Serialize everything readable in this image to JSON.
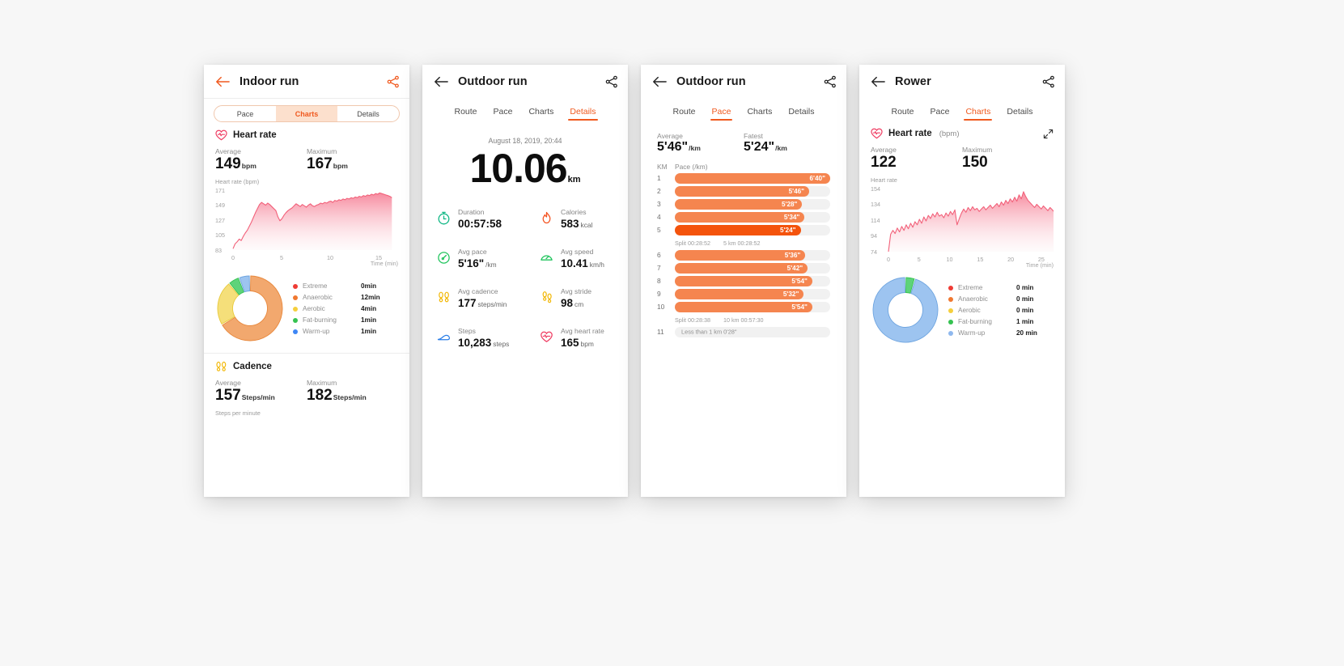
{
  "panels": [
    {
      "id": "indoor-run",
      "title": "Indoor run",
      "back_icon": "back-arrow-icon",
      "share_icon": "share-icon",
      "tab_style": "pill",
      "tabs": [
        {
          "label": "Pace",
          "active": false
        },
        {
          "label": "Charts",
          "active": true
        },
        {
          "label": "Details",
          "active": false
        }
      ],
      "heart_rate": {
        "icon": "heart-rate-icon",
        "title": "Heart rate",
        "unit_suffix": "",
        "average_label": "Average",
        "average_value": "149",
        "average_unit": "bpm",
        "maximum_label": "Maximum",
        "maximum_value": "167",
        "maximum_unit": "bpm",
        "axis_caption": "Heart rate (bpm)",
        "y_ticks": [
          "171",
          "149",
          "127",
          "105",
          "83"
        ],
        "x_ticks": [
          "0",
          "5",
          "10",
          "15"
        ],
        "time_caption": "Time (min)"
      },
      "zones": {
        "colors": {
          "extreme": "#ef3b34",
          "anaerobic": "#f07830",
          "aerobic": "#f5cf3d",
          "fat_burning": "#35c250",
          "warm_up": "#3e86f5"
        },
        "items": [
          {
            "name": "Extreme",
            "value": "0min",
            "color": "#ef3b34",
            "minutes": 0
          },
          {
            "name": "Anaerobic",
            "value": "12min",
            "color": "#f07830",
            "minutes": 12
          },
          {
            "name": "Aerobic",
            "value": "4min",
            "color": "#f5cf3d",
            "minutes": 4
          },
          {
            "name": "Fat-burning",
            "value": "1min",
            "color": "#35c250",
            "minutes": 1
          },
          {
            "name": "Warm-up",
            "value": "1min",
            "color": "#3e86f5",
            "minutes": 1
          }
        ]
      },
      "cadence": {
        "icon": "footsteps-icon",
        "title": "Cadence",
        "average_label": "Average",
        "average_value": "157",
        "average_unit": "Steps/min",
        "maximum_label": "Maximum",
        "maximum_value": "182",
        "maximum_unit": "Steps/min",
        "caption": "Steps per minute"
      }
    },
    {
      "id": "outdoor-run-details",
      "title": "Outdoor run",
      "back_icon": "back-arrow-icon",
      "share_icon": "share-icon",
      "tab_style": "underline",
      "tabs": [
        {
          "label": "Route",
          "active": false
        },
        {
          "label": "Pace",
          "active": false
        },
        {
          "label": "Charts",
          "active": false
        },
        {
          "label": "Details",
          "active": true
        }
      ],
      "details": {
        "date": "August 18, 2019, 20:44",
        "distance_value": "10.06",
        "distance_unit": "km",
        "stats": [
          {
            "icon": "stopwatch-icon",
            "label": "Duration",
            "value": "00:57:58",
            "unit": ""
          },
          {
            "icon": "flame-icon",
            "label": "Calories",
            "value": "583",
            "unit": "kcal"
          },
          {
            "icon": "gauge-icon",
            "label": "Avg pace",
            "value": "5'16\"",
            "unit": "/km"
          },
          {
            "icon": "speedometer-icon",
            "label": "Avg speed",
            "value": "10.41",
            "unit": "km/h"
          },
          {
            "icon": "footsteps-icon",
            "label": "Avg cadence",
            "value": "177",
            "unit": "steps/min"
          },
          {
            "icon": "stride-icon",
            "label": "Avg stride",
            "value": "98",
            "unit": "cm"
          },
          {
            "icon": "shoe-icon",
            "label": "Steps",
            "value": "10,283",
            "unit": "steps"
          },
          {
            "icon": "heart-rate-icon",
            "label": "Avg heart rate",
            "value": "165",
            "unit": "bpm"
          }
        ]
      }
    },
    {
      "id": "outdoor-run-pace",
      "title": "Outdoor run",
      "back_icon": "back-arrow-icon",
      "share_icon": "share-icon",
      "tab_style": "underline",
      "tabs": [
        {
          "label": "Route",
          "active": false
        },
        {
          "label": "Pace",
          "active": true
        },
        {
          "label": "Charts",
          "active": false
        },
        {
          "label": "Details",
          "active": false
        }
      ],
      "pace": {
        "average_label": "Average",
        "average_value": "5'46\"",
        "average_unit": "/km",
        "fastest_label": "Fatest",
        "fastest_value": "5'24\"",
        "fastest_unit": "/km",
        "col_km": "KM",
        "col_pace": "Pace (/km)",
        "rows": [
          {
            "km": "1",
            "pace": "6'40\"",
            "pct": 100,
            "fastest": false
          },
          {
            "km": "2",
            "pace": "5'46\"",
            "pct": 86.5,
            "fastest": false
          },
          {
            "km": "3",
            "pace": "5'28\"",
            "pct": 82.0,
            "fastest": false
          },
          {
            "km": "4",
            "pace": "5'34\"",
            "pct": 83.5,
            "fastest": false
          },
          {
            "km": "5",
            "pace": "5'24\"",
            "pct": 81.0,
            "fastest": true
          }
        ],
        "split1": {
          "split_label": "Split 00:28:52",
          "total_label": "5 km 00:28:52"
        },
        "rows2": [
          {
            "km": "6",
            "pace": "5'36\"",
            "pct": 84.0,
            "fastest": false
          },
          {
            "km": "7",
            "pace": "5'42\"",
            "pct": 85.5,
            "fastest": false
          },
          {
            "km": "8",
            "pace": "5'54\"",
            "pct": 88.5,
            "fastest": false
          },
          {
            "km": "9",
            "pace": "5'32\"",
            "pct": 83.0,
            "fastest": false
          },
          {
            "km": "10",
            "pace": "5'54\"",
            "pct": 88.5,
            "fastest": false
          }
        ],
        "split2": {
          "split_label": "Split 00:28:38",
          "total_label": "10 km 00:57:30"
        },
        "last_row": {
          "km": "11",
          "text": "Less than 1 km 0'28\""
        }
      }
    },
    {
      "id": "rower",
      "title": "Rower",
      "back_icon": "back-arrow-icon",
      "share_icon": "share-icon",
      "tab_style": "underline",
      "tabs": [
        {
          "label": "Route",
          "active": false
        },
        {
          "label": "Pace",
          "active": false
        },
        {
          "label": "Charts",
          "active": true
        },
        {
          "label": "Details",
          "active": false
        }
      ],
      "heart_rate": {
        "icon": "heart-rate-icon",
        "title": "Heart rate",
        "unit_suffix": "(bpm)",
        "expand_icon": "expand-icon",
        "average_label": "Average",
        "average_value": "122",
        "maximum_label": "Maximum",
        "maximum_value": "150",
        "axis_caption": "Heart rate",
        "y_ticks": [
          "154",
          "134",
          "114",
          "94",
          "74"
        ],
        "x_ticks": [
          "0",
          "5",
          "10",
          "15",
          "20",
          "25"
        ],
        "time_caption": "Time (min)"
      },
      "zones": {
        "items": [
          {
            "name": "Extreme",
            "value": "0 min",
            "color": "#ef3b34",
            "minutes": 0
          },
          {
            "name": "Anaerobic",
            "value": "0 min",
            "color": "#f07830",
            "minutes": 0
          },
          {
            "name": "Aerobic",
            "value": "0 min",
            "color": "#f5cf3d",
            "minutes": 0
          },
          {
            "name": "Fat-burning",
            "value": "1 min",
            "color": "#35c250",
            "minutes": 1
          },
          {
            "name": "Warm-up",
            "value": "20 min",
            "color": "#8fb8ee",
            "minutes": 20
          }
        ]
      }
    }
  ],
  "chart_data": [
    {
      "type": "area",
      "id": "indoor-run-heart-rate",
      "title": "Heart rate (bpm)",
      "xlabel": "Time (min)",
      "ylabel": "Heart rate (bpm)",
      "ylim": [
        83,
        171
      ],
      "xlim": [
        0,
        17
      ],
      "y_ticks": [
        83,
        105,
        127,
        149,
        171
      ],
      "x_ticks": [
        0,
        5,
        10,
        15
      ],
      "grid": true,
      "legend": false,
      "series": [
        {
          "name": "Heart rate",
          "color": "#f2617a",
          "values": [
            85,
            92,
            95,
            99,
            97,
            103,
            108,
            112,
            118,
            124,
            131,
            138,
            144,
            150,
            153,
            151,
            149,
            152,
            150,
            147,
            144,
            141,
            132,
            126,
            129,
            134,
            138,
            141,
            143,
            145,
            148,
            151,
            149,
            147,
            150,
            148,
            146,
            149,
            151,
            148,
            147,
            149,
            150,
            152,
            151,
            153,
            152,
            154,
            155,
            153,
            156,
            155,
            157,
            156,
            158,
            157,
            159,
            158,
            160,
            159,
            161,
            160,
            162,
            161,
            163,
            162,
            164,
            163,
            165,
            164,
            166,
            165,
            167,
            166,
            165,
            164,
            163,
            162,
            160
          ]
        }
      ]
    },
    {
      "type": "pie",
      "id": "indoor-run-heart-rate-zones",
      "title": "Heart rate zones",
      "labels": [
        "Extreme",
        "Anaerobic",
        "Aerobic",
        "Fat-burning",
        "Warm-up"
      ],
      "values": [
        0,
        12,
        4,
        1,
        1
      ],
      "unit": "min",
      "colors": [
        "#ef3b34",
        "#f2a86e",
        "#f5df7a",
        "#5ed37a",
        "#9dc4f0"
      ],
      "legend": "right",
      "donut": true
    },
    {
      "type": "bar",
      "id": "outdoor-run-pace-splits",
      "title": "Pace (/km)",
      "orientation": "horizontal",
      "xlabel": "Pace (/km)",
      "ylabel": "KM",
      "categories": [
        "1",
        "2",
        "3",
        "4",
        "5",
        "6",
        "7",
        "8",
        "9",
        "10"
      ],
      "values": [
        "6'40\"",
        "5'46\"",
        "5'28\"",
        "5'34\"",
        "5'24\"",
        "5'36\"",
        "5'42\"",
        "5'54\"",
        "5'32\"",
        "5'54\""
      ],
      "values_seconds": [
        400,
        346,
        328,
        334,
        324,
        336,
        342,
        354,
        332,
        354
      ],
      "highlight_index": 4,
      "highlight_label": "Fatest",
      "colors": {
        "bar": "#f5854f",
        "fastest": "#f4530c",
        "track": "#f1f1f1"
      },
      "annotations": [
        "Split 00:28:52 / 5 km 00:28:52",
        "Split 00:28:38 / 10 km 00:57:30",
        "Less than 1 km 0'28\""
      ]
    },
    {
      "type": "area",
      "id": "rower-heart-rate",
      "title": "Heart rate",
      "xlabel": "Time (min)",
      "ylabel": "Heart rate",
      "ylim": [
        74,
        154
      ],
      "xlim": [
        0,
        27
      ],
      "y_ticks": [
        74,
        94,
        114,
        134,
        154
      ],
      "x_ticks": [
        0,
        5,
        10,
        15,
        20,
        25
      ],
      "grid": true,
      "legend": false,
      "series": [
        {
          "name": "Heart rate",
          "color": "#f2617a",
          "values": [
            74,
            96,
            101,
            97,
            104,
            99,
            106,
            101,
            108,
            103,
            110,
            105,
            112,
            108,
            115,
            110,
            118,
            113,
            120,
            116,
            122,
            118,
            124,
            119,
            121,
            117,
            123,
            119,
            125,
            121,
            127,
            108,
            116,
            123,
            128,
            124,
            130,
            126,
            131,
            127,
            129,
            125,
            128,
            131,
            127,
            130,
            133,
            129,
            132,
            135,
            131,
            137,
            133,
            139,
            135,
            141,
            137,
            143,
            138,
            146,
            141,
            150,
            144,
            139,
            136,
            133,
            130,
            134,
            131,
            128,
            132,
            129,
            126,
            130,
            127,
            124
          ]
        }
      ]
    },
    {
      "type": "pie",
      "id": "rower-heart-rate-zones",
      "title": "Heart rate zones",
      "labels": [
        "Extreme",
        "Anaerobic",
        "Aerobic",
        "Fat-burning",
        "Warm-up"
      ],
      "values": [
        0,
        0,
        0,
        1,
        20
      ],
      "unit": "min",
      "colors": [
        "#ef3b34",
        "#f2a86e",
        "#f5df7a",
        "#5ed37a",
        "#9dc4f0"
      ],
      "legend": "right",
      "donut": true
    }
  ]
}
